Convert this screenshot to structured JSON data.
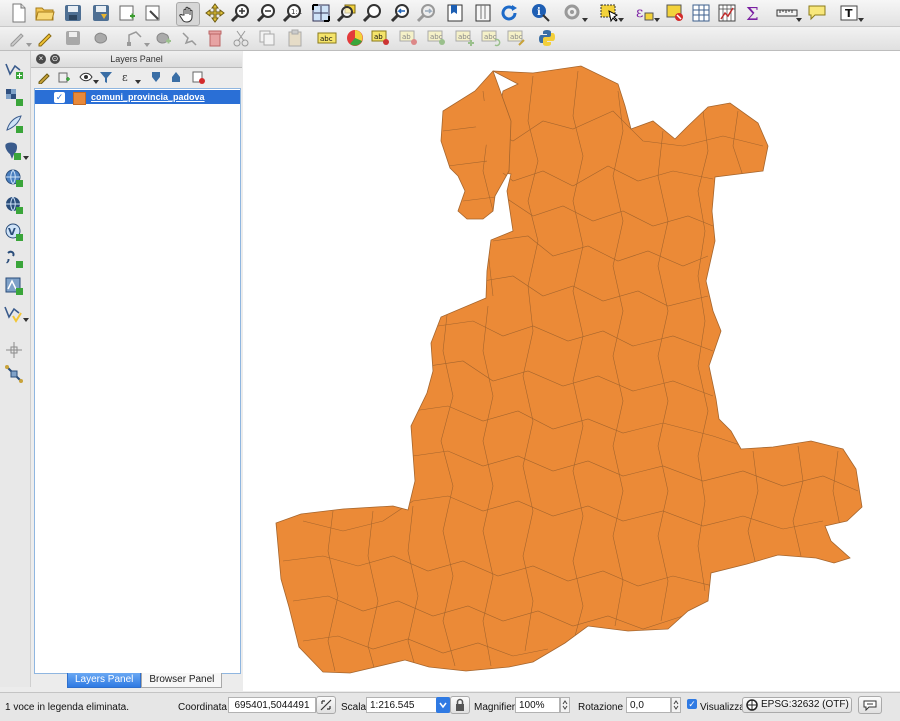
{
  "toolbar_top": {
    "icons": [
      "new-project-icon",
      "open-project-icon",
      "save-project-icon",
      "save-as-icon",
      "new-print-composer-icon",
      "composer-manager-icon",
      "pan-icon",
      "pan-to-selection-icon",
      "zoom-in-icon",
      "zoom-out-icon",
      "zoom-actual-size-icon",
      "zoom-full-icon",
      "zoom-to-selection-icon",
      "zoom-to-layer-icon",
      "zoom-last-icon",
      "zoom-next-icon",
      "new-bookmark-icon",
      "refresh-icon",
      "identify-icon",
      "map-tips-icon",
      "select-features-icon",
      "deselect-icon",
      "field-calculator-icon",
      "attribute-table-icon",
      "statistics-icon",
      "measure-icon",
      "annotation-icon",
      "text-annotation-icon"
    ]
  },
  "toolbar_second": {
    "icons": [
      "current-edits-icon",
      "toggle-editing-icon",
      "save-edits-icon",
      "add-feature-icon",
      "node-tool-icon",
      "move-feature-icon",
      "delete-selected-icon",
      "cut-features-icon",
      "copy-features-icon",
      "paste-features-icon",
      "label-icon",
      "diagram-icon",
      "pin-label-icon",
      "show-hide-label-icon",
      "move-label-icon",
      "rotate-label-icon",
      "change-label-icon",
      "python-console-icon"
    ]
  },
  "left_toolbar": {
    "icons": [
      "add-vector-layer-icon",
      "add-raster-layer-icon",
      "add-spatialite-layer-icon",
      "add-postgis-layer-icon",
      "add-wms-layer-icon",
      "add-wcs-layer-icon",
      "add-wfs-layer-icon",
      "add-delimited-text-icon",
      "add-mssql-layer-icon",
      "new-shapefile-icon",
      "add-oracle-layer-icon",
      "gps-tool-icon"
    ]
  },
  "layers_panel": {
    "title": "Layers Panel",
    "layers": [
      {
        "name": "comuni_provincia_padova",
        "visible": true,
        "color": "#e8893a",
        "selected": true
      }
    ]
  },
  "bottom_tabs": [
    {
      "label": "Layers Panel",
      "active": true
    },
    {
      "label": "Browser Panel",
      "active": false
    }
  ],
  "map": {
    "fill_color": "#eb8a37",
    "stroke_color": "#a5652d",
    "background": "#ffffff"
  },
  "status_bar": {
    "message": "1 voce in legenda eliminata.",
    "coordinate_label": "Coordinata",
    "coordinate_value": "695401,5044491",
    "scale_label": "Scala",
    "scale_value": "1:216.545",
    "magnifier_label": "Magnifier",
    "magnifier_value": "100%",
    "rotation_label": "Rotazione",
    "rotation_value": "0,0",
    "render_label": "Visualizza",
    "render_checked": true,
    "crs": "EPSG:32632 (OTF)"
  }
}
